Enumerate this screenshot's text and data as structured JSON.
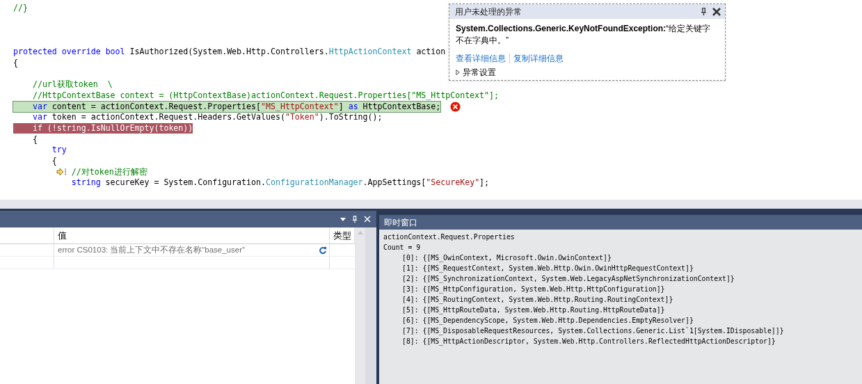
{
  "editor": {
    "lines": [
      {
        "kind": "code",
        "current": false,
        "breakpoint": false,
        "step_marker": false,
        "tokens": [
          {
            "kind": "comment",
            "text": "//}"
          }
        ]
      },
      {
        "kind": "blank"
      },
      {
        "kind": "blank"
      },
      {
        "kind": "blank"
      },
      {
        "kind": "code",
        "current": false,
        "breakpoint": false,
        "step_marker": false,
        "tokens": [
          {
            "kind": "keyword",
            "text": "protected "
          },
          {
            "kind": "keyword",
            "text": "override "
          },
          {
            "kind": "keyword",
            "text": "bool"
          },
          {
            "kind": "text",
            "text": " IsAuthorized(System.Web.Http.Controllers."
          },
          {
            "kind": "type",
            "text": "HttpActionContext"
          },
          {
            "kind": "text",
            "text": " action"
          }
        ]
      },
      {
        "kind": "code",
        "current": false,
        "breakpoint": false,
        "step_marker": false,
        "tokens": [
          {
            "kind": "text",
            "text": "{"
          }
        ]
      },
      {
        "kind": "blank"
      },
      {
        "kind": "code",
        "current": false,
        "breakpoint": false,
        "step_marker": false,
        "tokens": [
          {
            "kind": "comment",
            "text": "    //url获取token  \\"
          }
        ]
      },
      {
        "kind": "code",
        "current": false,
        "breakpoint": false,
        "step_marker": false,
        "tokens": [
          {
            "kind": "comment",
            "text": "    //HttpContextBase context = (HttpContextBase)actionContext.Request.Properties[\"MS_HttpContext\"];"
          }
        ]
      },
      {
        "kind": "code",
        "current": true,
        "breakpoint": false,
        "step_marker": false,
        "tokens": [
          {
            "kind": "keyword",
            "text": "    var"
          },
          {
            "kind": "text",
            "text": " content = actionContext.Request.Properties["
          },
          {
            "kind": "string",
            "text": "\"MS_HttpContext\""
          },
          {
            "kind": "text",
            "text": "] "
          },
          {
            "kind": "keyword",
            "text": "as"
          },
          {
            "kind": "text",
            "text": " HttpContextBase;"
          }
        ]
      },
      {
        "kind": "code",
        "current": false,
        "breakpoint": false,
        "step_marker": false,
        "tokens": [
          {
            "kind": "keyword",
            "text": "    var"
          },
          {
            "kind": "text",
            "text": " token = actionContext.Request.Headers.GetValues("
          },
          {
            "kind": "string",
            "text": "\"Token\""
          },
          {
            "kind": "text",
            "text": ").ToString();"
          }
        ]
      },
      {
        "kind": "code",
        "current": false,
        "breakpoint": true,
        "step_marker": false,
        "tokens": [
          {
            "kind": "keyword",
            "text": "    if"
          },
          {
            "kind": "text",
            "text": " (!"
          },
          {
            "kind": "keyword",
            "text": "string"
          },
          {
            "kind": "text",
            "text": ".IsNullOrEmpty(token))"
          }
        ]
      },
      {
        "kind": "code",
        "current": false,
        "breakpoint": false,
        "step_marker": false,
        "tokens": [
          {
            "kind": "text",
            "text": "    {"
          }
        ]
      },
      {
        "kind": "code",
        "current": false,
        "breakpoint": false,
        "step_marker": false,
        "tokens": [
          {
            "kind": "keyword",
            "text": "        try"
          }
        ]
      },
      {
        "kind": "code",
        "current": false,
        "breakpoint": false,
        "step_marker": false,
        "tokens": [
          {
            "kind": "text",
            "text": "        {"
          }
        ]
      },
      {
        "kind": "code",
        "current": false,
        "breakpoint": false,
        "step_marker": true,
        "tokens": [
          {
            "kind": "comment",
            "text": "            //对token进行解密"
          }
        ]
      },
      {
        "kind": "code",
        "current": false,
        "breakpoint": false,
        "step_marker": false,
        "tokens": [
          {
            "kind": "keyword",
            "text": "            string"
          },
          {
            "kind": "text",
            "text": " secureKey = System.Configuration."
          },
          {
            "kind": "type",
            "text": "ConfigurationManager"
          },
          {
            "kind": "text",
            "text": ".AppSettings["
          },
          {
            "kind": "string",
            "text": "\"SecureKey\""
          },
          {
            "kind": "text",
            "text": "];"
          }
        ]
      }
    ]
  },
  "exception_popup": {
    "title": "用户未处理的异常",
    "exception_type": "System.Collections.Generic.KeyNotFoundException:",
    "message": "“给定关键字不在字典中。”",
    "links": [
      "查看详细信息",
      "复制详细信息"
    ],
    "settings": {
      "label": "异常设置",
      "expanded": false
    }
  },
  "locals_panel": {
    "columns": [
      "值",
      "类型"
    ],
    "rows": [
      {
        "value": "error CS0103: 当前上下文中不存在名称“base_user”"
      }
    ]
  },
  "immediate_window": {
    "title": "即时窗口",
    "lines": [
      {
        "text": "actionContext.Request.Properties"
      },
      {
        "text": "Count = 9",
        "children": [
          {
            "text": "[0]: {[MS_OwinContext, Microsoft.Owin.OwinContext]}"
          },
          {
            "text": "[1]: {[MS_RequestContext, System.Web.Http.Owin.OwinHttpRequestContext]}"
          },
          {
            "text": "[2]: {[MS_SynchronizationContext, System.Web.LegacyAspNetSynchronizationContext]}"
          },
          {
            "text": "[3]: {[MS_HttpConfiguration, System.Web.Http.HttpConfiguration]}"
          },
          {
            "text": "[4]: {[MS_RoutingContext, System.Web.Http.Routing.RoutingContext]}"
          },
          {
            "text": "[5]: {[MS_HttpRouteData, System.Web.Http.Routing.HttpRouteData]}"
          },
          {
            "text": "[6]: {[MS_DependencyScope, System.Web.Http.Dependencies.EmptyResolver]}"
          },
          {
            "text": "[7]: {[MS_DisposableRequestResources, System.Collections.Generic.List`1[System.IDisposable]]}"
          },
          {
            "text": "[8]: {[MS_HttpActionDescriptor, System.Web.Http.Controllers.ReflectedHttpActionDescriptor]}"
          }
        ]
      }
    ]
  }
}
